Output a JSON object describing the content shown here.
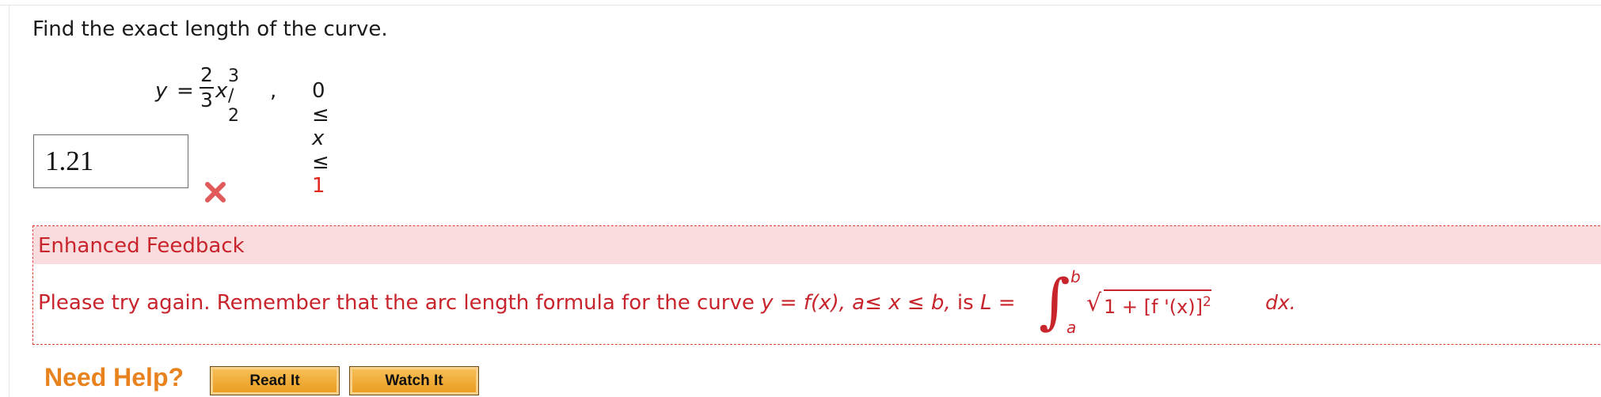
{
  "question": {
    "prompt": "Find the exact length of the curve.",
    "formula": {
      "lhs": "y",
      "equals": "=",
      "numerator": "2",
      "denominator": "3",
      "variable": "x",
      "exponent": "3 / 2",
      "comma": ",",
      "domain_lower": "0 ≤",
      "domain_var": "x",
      "domain_le": "≤",
      "domain_upper": "1"
    }
  },
  "answer": {
    "value": "1.21",
    "status": "incorrect"
  },
  "feedback": {
    "title": "Enhanced Feedback",
    "text_before": "Please try again. Remember that the arc length formula for the curve ",
    "curve": "y = f(x), a≤ x ≤ b,",
    "text_is": " is ",
    "L": "L",
    "eq": " =",
    "integral_upper": "b",
    "integral_lower": "a",
    "radicand": "1 + [f '(x)]",
    "radicand_exp": "2",
    "dx": "dx."
  },
  "help": {
    "label": "Need Help?",
    "read_button": "Read It",
    "watch_button": "Watch It"
  },
  "colors": {
    "error_red": "#c8242c",
    "highlight_red": "#e0281c",
    "feedback_bg": "#fadcde",
    "help_orange": "#e8821e"
  }
}
